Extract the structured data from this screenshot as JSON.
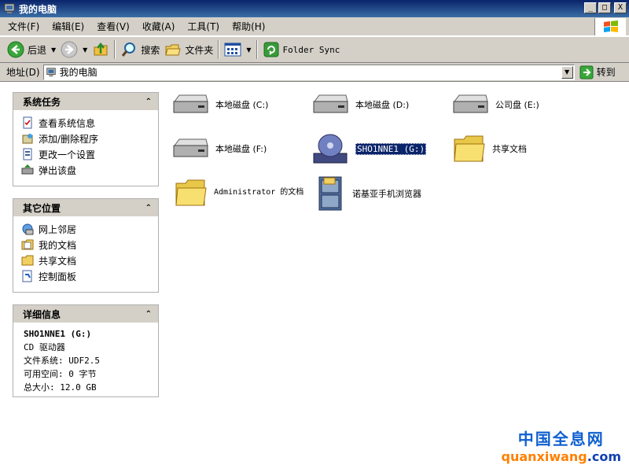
{
  "window": {
    "title": "我的电脑"
  },
  "window_controls": {
    "minimize": "_",
    "maximize": "□",
    "close": "X"
  },
  "menu": [
    "文件(F)",
    "编辑(E)",
    "查看(V)",
    "收藏(A)",
    "工具(T)",
    "帮助(H)"
  ],
  "toolbar": {
    "back": "后退",
    "search": "搜索",
    "folders": "文件夹",
    "folder_sync": "Folder Sync"
  },
  "address": {
    "label": "地址(D)",
    "value": "我的电脑",
    "go": "转到"
  },
  "panels": {
    "system_tasks": {
      "title": "系统任务",
      "items": [
        "查看系统信息",
        "添加/删除程序",
        "更改一个设置",
        "弹出该盘"
      ]
    },
    "other_places": {
      "title": "其它位置",
      "items": [
        "网上邻居",
        "我的文档",
        "共享文档",
        "控制面板"
      ]
    },
    "details": {
      "title": "详细信息",
      "name": "SHO1NNE1 (G:)",
      "type": "CD 驱动器",
      "filesystem": "文件系统: UDF2.5",
      "free": "可用空间: 0 字节",
      "total": "总大小: 12.0 GB"
    }
  },
  "items": [
    {
      "label": "本地磁盘 (C:)",
      "icon": "hard-drive-icon"
    },
    {
      "label": "本地磁盘 (D:)",
      "icon": "hard-drive-icon"
    },
    {
      "label": "公司盘 (E:)",
      "icon": "hard-drive-icon"
    },
    {
      "label": "本地磁盘 (F:)",
      "icon": "hard-drive-icon"
    },
    {
      "label": "SHO1NNE1 (G:)",
      "icon": "cd-drive-icon"
    },
    {
      "label": "共享文档",
      "icon": "folder-icon"
    },
    {
      "label": "Administrator 的文档",
      "icon": "folder-icon"
    },
    {
      "label": "诺基亚手机浏览器",
      "icon": "file-cabinet-icon"
    }
  ],
  "watermark": {
    "cn": "中国全息网",
    "en_a": "quanxiwang",
    "en_b": ".com"
  }
}
